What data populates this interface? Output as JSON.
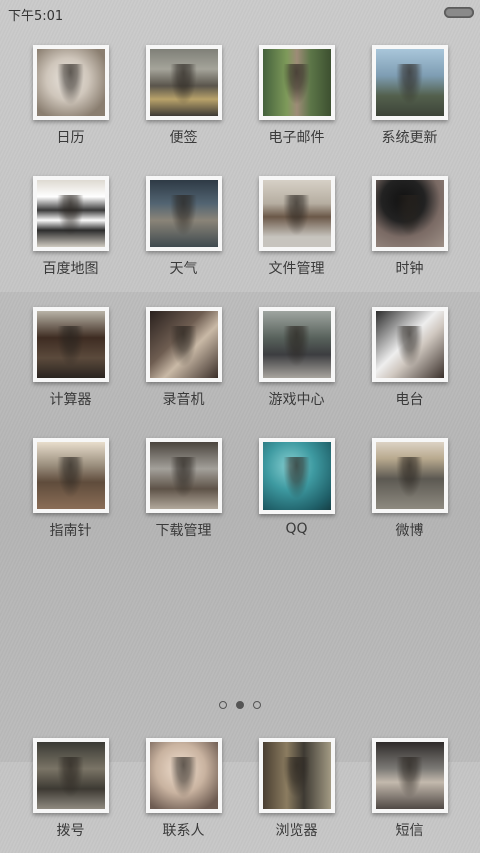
{
  "status_bar": {
    "time": "下午5:01"
  },
  "home": {
    "apps": [
      {
        "label": "日历",
        "icon": "calendar-icon"
      },
      {
        "label": "便签",
        "icon": "notes-icon"
      },
      {
        "label": "电子邮件",
        "icon": "email-icon"
      },
      {
        "label": "系统更新",
        "icon": "system-update-icon"
      },
      {
        "label": "百度地图",
        "icon": "map-icon"
      },
      {
        "label": "天气",
        "icon": "weather-icon"
      },
      {
        "label": "文件管理",
        "icon": "file-manager-icon"
      },
      {
        "label": "时钟",
        "icon": "clock-icon"
      },
      {
        "label": "计算器",
        "icon": "calculator-icon"
      },
      {
        "label": "录音机",
        "icon": "recorder-icon"
      },
      {
        "label": "游戏中心",
        "icon": "game-center-icon"
      },
      {
        "label": "电台",
        "icon": "radio-icon"
      },
      {
        "label": "指南针",
        "icon": "compass-icon"
      },
      {
        "label": "下载管理",
        "icon": "download-manager-icon"
      },
      {
        "label": "QQ",
        "icon": "qq-icon"
      },
      {
        "label": "微博",
        "icon": "weibo-icon"
      }
    ],
    "pages": {
      "count": 3,
      "active": 2
    }
  },
  "dock": {
    "apps": [
      {
        "label": "拨号",
        "icon": "phone-icon"
      },
      {
        "label": "联系人",
        "icon": "contacts-icon"
      },
      {
        "label": "浏览器",
        "icon": "browser-icon"
      },
      {
        "label": "短信",
        "icon": "sms-icon"
      }
    ]
  }
}
